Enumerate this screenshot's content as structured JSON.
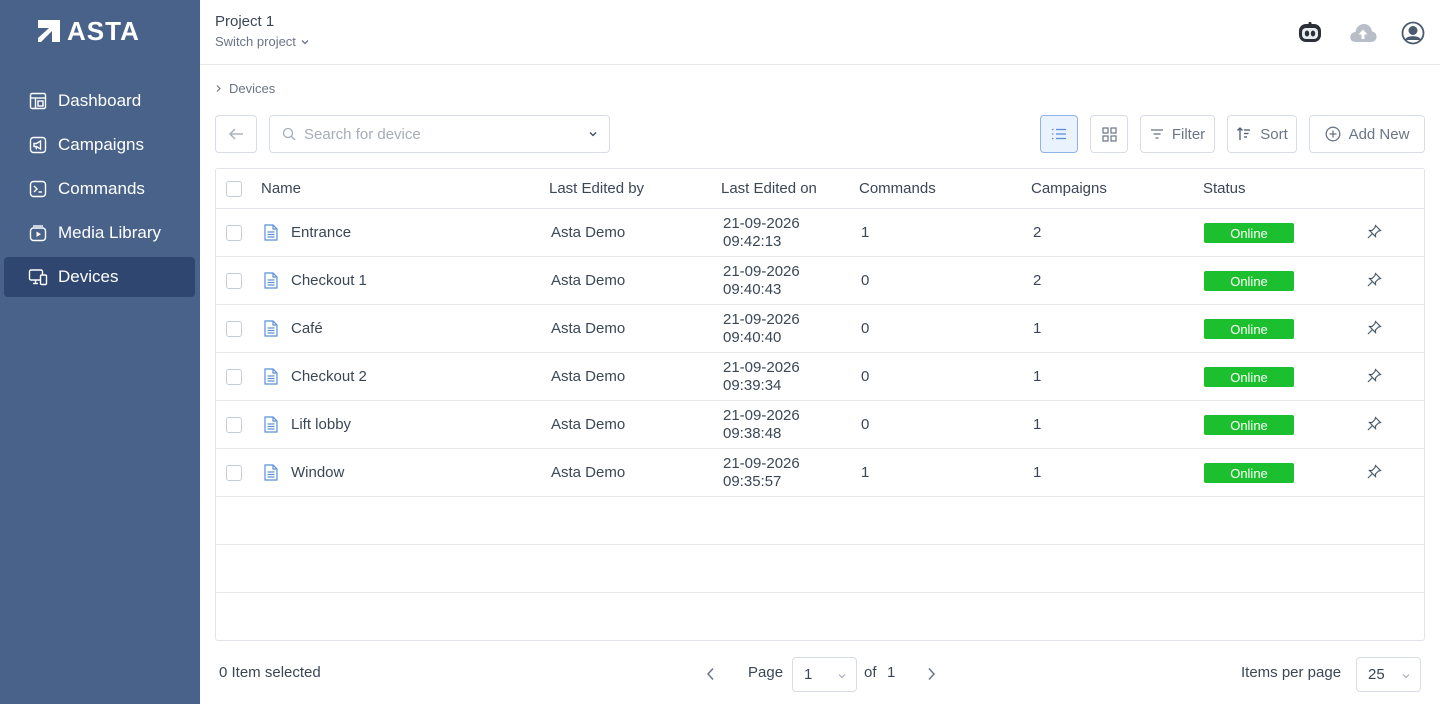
{
  "brand": {
    "name": "ASTA"
  },
  "sidebar": {
    "items": [
      {
        "label": "Dashboard",
        "icon": "dashboard-icon"
      },
      {
        "label": "Campaigns",
        "icon": "megaphone-icon"
      },
      {
        "label": "Commands",
        "icon": "terminal-icon"
      },
      {
        "label": "Media Library",
        "icon": "media-icon"
      },
      {
        "label": "Devices",
        "icon": "devices-icon",
        "active": true
      }
    ]
  },
  "header": {
    "project": "Project 1",
    "switch_label": "Switch project"
  },
  "breadcrumb": {
    "current": "Devices"
  },
  "toolbar": {
    "search_placeholder": "Search for device",
    "filter_label": "Filter",
    "sort_label": "Sort",
    "add_label": "Add New"
  },
  "table": {
    "columns": [
      "Name",
      "Last Edited by",
      "Last Edited on",
      "Commands",
      "Campaigns",
      "Status"
    ],
    "rows": [
      {
        "name": "Entrance",
        "editor": "Asta Demo",
        "date": "21-09-2026",
        "time": "09:42:13",
        "commands": "1",
        "campaigns": "2",
        "status": "Online"
      },
      {
        "name": "Checkout 1",
        "editor": "Asta Demo",
        "date": "21-09-2026",
        "time": "09:40:43",
        "commands": "0",
        "campaigns": "2",
        "status": "Online"
      },
      {
        "name": "Café",
        "editor": "Asta Demo",
        "date": "21-09-2026",
        "time": "09:40:40",
        "commands": "0",
        "campaigns": "1",
        "status": "Online"
      },
      {
        "name": "Checkout 2",
        "editor": "Asta Demo",
        "date": "21-09-2026",
        "time": "09:39:34",
        "commands": "0",
        "campaigns": "1",
        "status": "Online"
      },
      {
        "name": "Lift lobby",
        "editor": "Asta Demo",
        "date": "21-09-2026",
        "time": "09:38:48",
        "commands": "0",
        "campaigns": "1",
        "status": "Online"
      },
      {
        "name": "Window",
        "editor": "Asta Demo",
        "date": "21-09-2026",
        "time": "09:35:57",
        "commands": "1",
        "campaigns": "1",
        "status": "Online"
      }
    ]
  },
  "footer": {
    "selected_text": "0 Item selected",
    "page_label": "Page",
    "page_value": "1",
    "of_label": "of",
    "total_pages": "1",
    "per_page_label": "Items per page",
    "per_page_value": "25"
  },
  "colors": {
    "sidebar_bg": "#48628a",
    "sidebar_active": "#2f4670",
    "status_online": "#1cbf2e",
    "accent": "#5b8fd9"
  }
}
